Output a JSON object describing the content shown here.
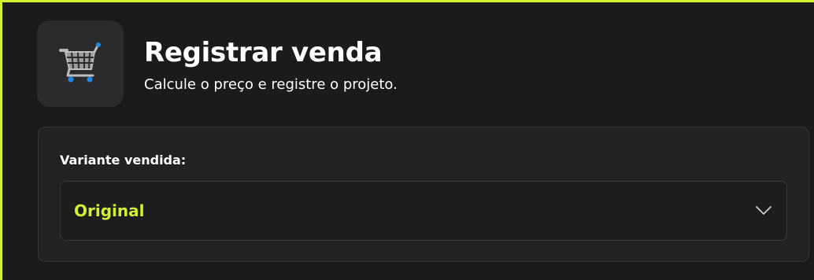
{
  "header": {
    "icon": "shopping-cart-icon",
    "title": "Registrar venda",
    "subtitle": "Calcule o preço e registre o projeto."
  },
  "form": {
    "variant_label": "Variante vendida:",
    "variant_selected": "Original"
  },
  "colors": {
    "accent": "#d4f035",
    "background": "#1b1b1b",
    "card": "#222224",
    "icon_box": "#2b2b2e",
    "cart_wheels": "#1e88e5"
  }
}
